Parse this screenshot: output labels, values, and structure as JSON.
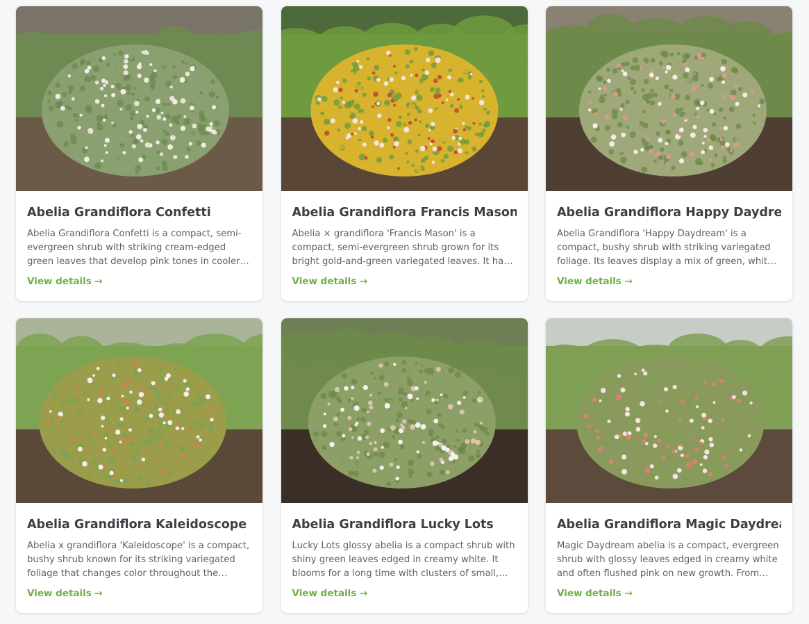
{
  "cards": [
    {
      "title": "Abelia Grandiflora Confetti",
      "description": "Abelia Grandiflora Confetti is a compact, semi-evergreen shrub with striking cream-edged green leaves that develop pink tones in cooler weather. I...",
      "link": "View details →",
      "photo": {
        "sky": "#7a7468",
        "ground": "#6b5a48",
        "lawn": "#6e8a52",
        "foliage": "#8aa070",
        "accent": "#e9e1d6",
        "flower": "#f2ece4"
      }
    },
    {
      "title": "Abelia Grandiflora Francis Mason",
      "description": "Abelia × grandiflora 'Francis Mason' is a compact, semi-evergreen shrub grown for its bright gold-and-green variegated leaves. It has arching stems...",
      "link": "View details →",
      "photo": {
        "sky": "#4f6a3a",
        "ground": "#5a4636",
        "lawn": "#6f9a3f",
        "foliage": "#d7b32e",
        "accent": "#c8522f",
        "flower": "#f1e6dc"
      }
    },
    {
      "title": "Abelia Grandiflora Happy Daydream",
      "description": "Abelia Grandiflora 'Happy Daydream' is a compact, bushy shrub with striking variegated foliage. Its leaves display a mix of green, white, and pink,...",
      "link": "View details →",
      "photo": {
        "sky": "#8a8172",
        "ground": "#4f3f33",
        "lawn": "#6d8a4a",
        "foliage": "#9fa878",
        "accent": "#d99a86",
        "flower": "#f3ebe6"
      }
    },
    {
      "title": "Abelia Grandiflora Kaleidoscope",
      "description": "Abelia x grandiflora 'Kaleidoscope' is a compact, bushy shrub known for its striking variegated foliage that changes color throughout the seasons....",
      "link": "View details →",
      "photo": {
        "sky": "#a9b49a",
        "ground": "#5a4838",
        "lawn": "#7ea352",
        "foliage": "#9b9d4a",
        "accent": "#c98552",
        "flower": "#f3eee8"
      }
    },
    {
      "title": "Abelia Grandiflora Lucky Lots",
      "description": "Lucky Lots glossy abelia is a compact shrub with shiny green leaves edged in creamy white. It blooms for a long time with clusters of small, creamy white...",
      "link": "View details →",
      "photo": {
        "sky": "#6e7f55",
        "ground": "#3b2e26",
        "lawn": "#6f8a4a",
        "foliage": "#8b9f66",
        "accent": "#d9c4ac",
        "flower": "#f6f2ee"
      }
    },
    {
      "title": "Abelia Grandiflora Magic Daydream",
      "description": "Magic Daydream abelia is a compact, evergreen shrub with glossy leaves edged in creamy white and often flushed pink on new growth. From summer...",
      "link": "View details →",
      "photo": {
        "sky": "#c7ccc7",
        "ground": "#5c4a3c",
        "lawn": "#7f9f55",
        "foliage": "#8a9a5c",
        "accent": "#d9836e",
        "flower": "#f2e5df"
      }
    }
  ]
}
